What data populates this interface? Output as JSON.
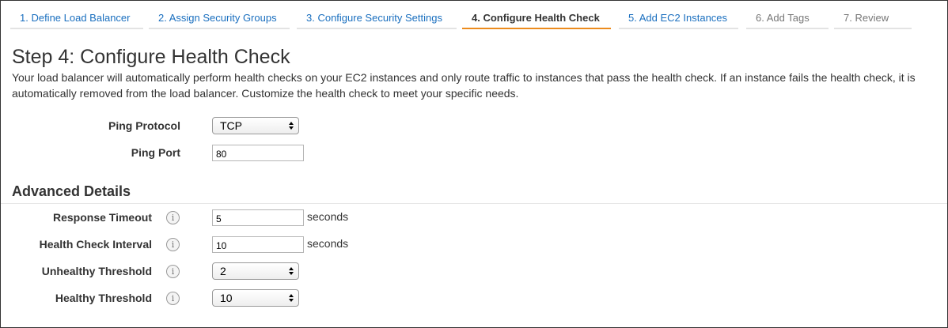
{
  "wizard": {
    "tabs": [
      {
        "label": "1. Define Load Balancer",
        "state": "link"
      },
      {
        "label": "2. Assign Security Groups",
        "state": "link"
      },
      {
        "label": "3. Configure Security Settings",
        "state": "link"
      },
      {
        "label": "4. Configure Health Check",
        "state": "active"
      },
      {
        "label": "5. Add EC2 Instances",
        "state": "link"
      },
      {
        "label": "6. Add Tags",
        "state": "disabled"
      },
      {
        "label": "7. Review",
        "state": "disabled"
      }
    ]
  },
  "step": {
    "title": "Step 4: Configure Health Check",
    "description": "Your load balancer will automatically perform health checks on your EC2 instances and only route traffic to instances that pass the health check. If an instance fails the health check, it is automatically removed from the load balancer. Customize the health check to meet your specific needs."
  },
  "ping": {
    "protocol_label": "Ping Protocol",
    "protocol_value": "TCP",
    "port_label": "Ping Port",
    "port_value": "80"
  },
  "advanced": {
    "title": "Advanced Details",
    "response_timeout": {
      "label": "Response Timeout",
      "value": "5",
      "unit": "seconds"
    },
    "interval": {
      "label": "Health Check Interval",
      "value": "10",
      "unit": "seconds"
    },
    "unhealthy_threshold": {
      "label": "Unhealthy Threshold",
      "value": "2"
    },
    "healthy_threshold": {
      "label": "Healthy Threshold",
      "value": "10"
    },
    "info_glyph": "i"
  },
  "colors": {
    "link": "#1a6fbf",
    "active_tab_underline": "#ec8b1d",
    "text": "#333333"
  }
}
